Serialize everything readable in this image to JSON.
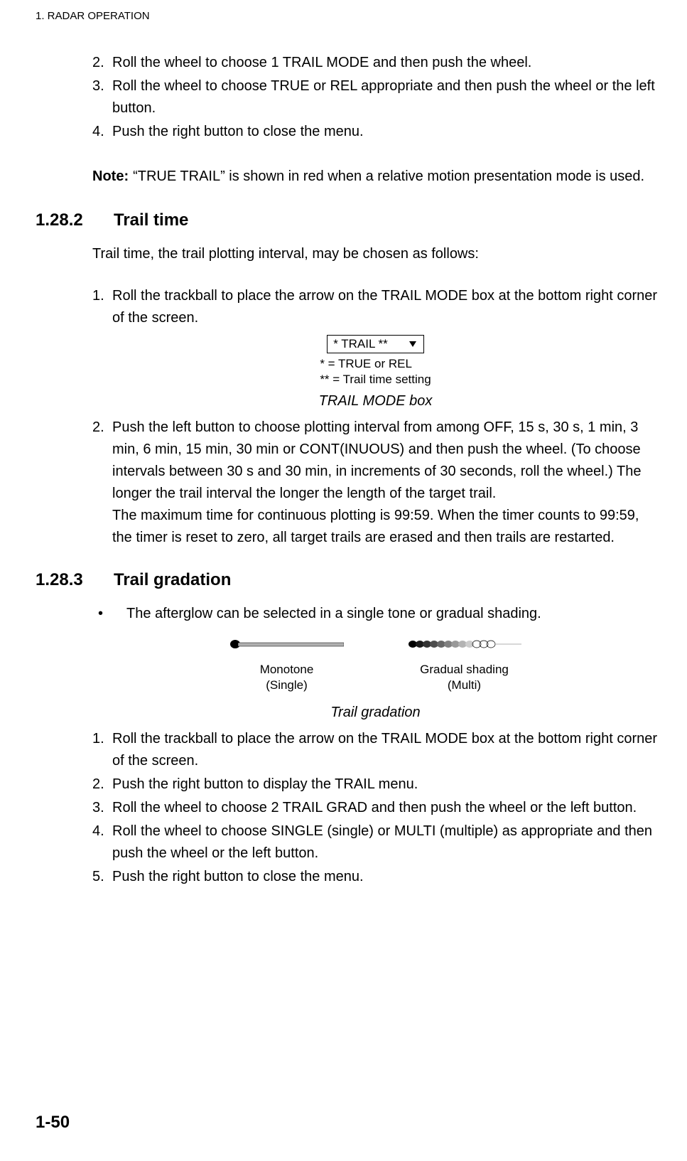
{
  "header": "1. RADAR OPERATION",
  "top_list": [
    {
      "num": "2.",
      "text": "Roll the wheel to choose 1 TRAIL MODE and then push the wheel."
    },
    {
      "num": "3.",
      "text": "Roll the wheel to choose TRUE or REL appropriate and then push the wheel or the left button."
    },
    {
      "num": "4.",
      "text": "Push the right button to close the menu."
    }
  ],
  "note": {
    "label": "Note:",
    "text": "“TRUE TRAIL” is shown in red when a relative motion presentation mode is used."
  },
  "section_1282": {
    "num": "1.28.2",
    "title": "Trail time",
    "intro": "Trail time, the trail plotting interval, may be chosen as follows:",
    "items": [
      {
        "num": "1.",
        "text": "Roll the trackball to place the arrow on the TRAIL MODE box at the bottom right corner of the screen."
      },
      {
        "num": "2.",
        "text": "Push the left button to choose plotting interval from among OFF, 15 s, 30 s, 1 min, 3 min, 6 min, 15 min, 30 min or CONT(INUOUS) and then push the wheel. (To choose intervals between 30 s and 30 min, in increments of 30 seconds, roll the wheel.) The longer the trail interval the longer the length of the target trail.\nThe maximum time for continuous plotting is 99:59. When the timer counts to 99:59, the timer is reset to zero, all target trails are erased and then trails are restarted."
      }
    ],
    "trail_box_label": "* TRAIL **",
    "trail_legend1": "*   = TRUE or REL",
    "trail_legend2": "** = Trail time setting",
    "caption": "TRAIL MODE box"
  },
  "section_1283": {
    "num": "1.28.3",
    "title": "Trail gradation",
    "bullet": "The afterglow can be selected in a single tone or gradual shading.",
    "monotone_label1": "Monotone",
    "monotone_label2": "(Single)",
    "gradual_label1": "Gradual shading",
    "gradual_label2": "(Multi)",
    "caption": "Trail gradation",
    "items": [
      {
        "num": "1.",
        "text": "Roll the trackball to place the arrow on the TRAIL MODE box at the bottom right corner of the screen."
      },
      {
        "num": "2.",
        "text": "Push the right button to display the TRAIL menu."
      },
      {
        "num": "3.",
        "text": "Roll the wheel to choose 2 TRAIL GRAD and then push the wheel or the left button."
      },
      {
        "num": "4.",
        "text": "Roll the wheel to choose SINGLE (single) or MULTI (multiple) as appropriate and then push the wheel or the left button."
      },
      {
        "num": "5.",
        "text": "Push the right button to close the menu."
      }
    ]
  },
  "footer": "1-50"
}
